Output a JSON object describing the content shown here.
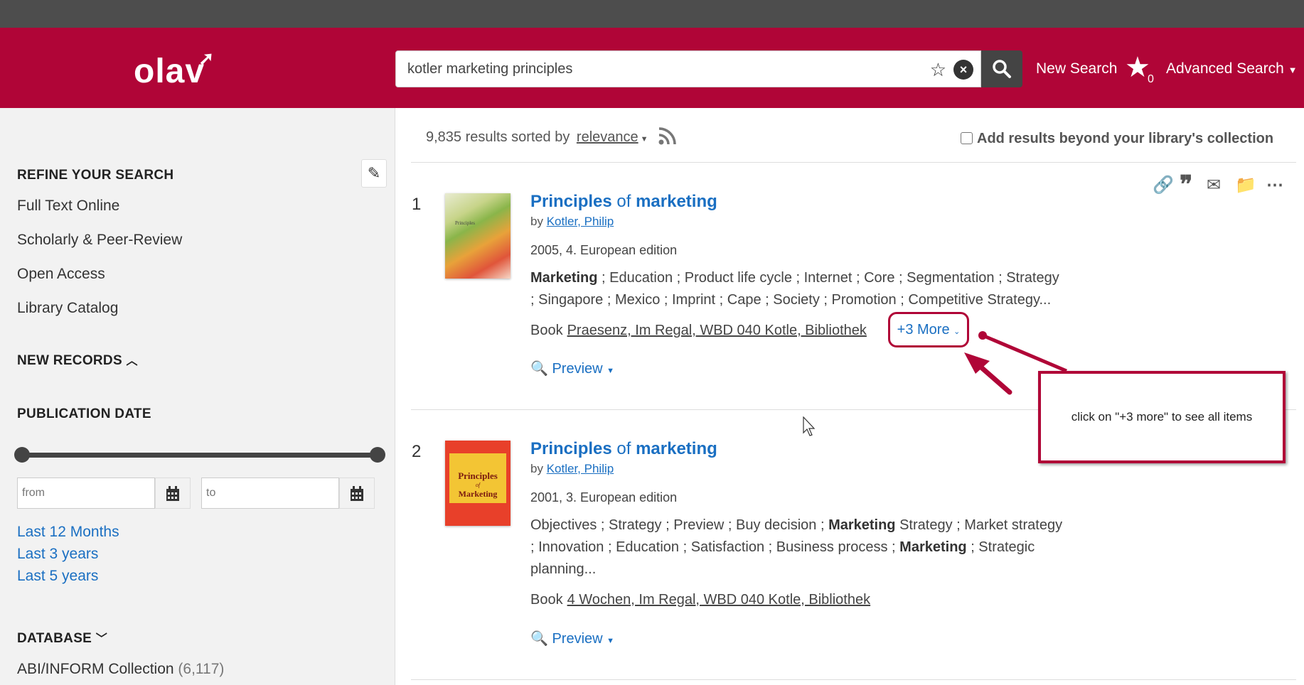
{
  "header": {
    "logo": "olav",
    "search_value": "kotler marketing principles",
    "new_search": "New Search",
    "fav_count": "0",
    "advanced_search": "Advanced Search"
  },
  "sidebar": {
    "refine_heading": "REFINE YOUR SEARCH",
    "refine_items": [
      "Full Text Online",
      "Scholarly & Peer-Review",
      "Open Access",
      "Library Catalog"
    ],
    "new_records": "NEW RECORDS",
    "pub_date": "PUBLICATION DATE",
    "from_placeholder": "from",
    "to_placeholder": "to",
    "date_links": [
      "Last 12 Months",
      "Last 3 years",
      "Last 5 years"
    ],
    "database_heading": "DATABASE",
    "db_first": "ABI/INFORM Collection",
    "db_first_count": "(6,117)"
  },
  "results": {
    "count_text": "9,835 results sorted by",
    "sort": "relevance",
    "beyond": "Add results beyond your library's collection",
    "records": [
      {
        "num": "1",
        "title_a": "Principles",
        "title_b": " of ",
        "title_c": "marketing",
        "by": "by",
        "author": "Kotler, Philip",
        "edition": "2005, 4. European edition",
        "subjects_line1_bold": "Marketing",
        "subjects_line1": " ; Education ; Product life cycle ; Internet ; Core ; Segmentation ; Strategy",
        "subjects_line2": "; Singapore ; Mexico ; Imprint ; Cape ; Society ; Promotion ; Competitive Strategy...",
        "format": "Book",
        "location": "Praesenz, Im Regal, WBD 040 Kotle, Bibliothek",
        "more": "+3 More",
        "preview": "Preview"
      },
      {
        "num": "2",
        "title_a": "Principles",
        "title_b": " of ",
        "title_c": "marketing",
        "by": "by",
        "author": "Kotler, Philip",
        "edition": "2001, 3. European edition",
        "subjects_line1_pre": "Objectives ; Strategy ; Preview ; Buy decision ; ",
        "subjects_line1_bold": "Marketing",
        "subjects_line1_post": " Strategy ; Market strategy",
        "subjects_line2_pre": "; Innovation ; Education ; Satisfaction ; Business process ; ",
        "subjects_line2_bold": "Marketing",
        "subjects_line2_post": " ; Strategic",
        "subjects_line3": "planning...",
        "format": "Book",
        "location": "4 Wochen, Im Regal, WBD 040 Kotle, Bibliothek",
        "preview": "Preview",
        "cover_title": "Principles",
        "cover_of": "of",
        "cover_marketing": "Marketing"
      }
    ]
  },
  "annotation": {
    "text": "click on \"+3 more\" to see all items",
    "color": "#b00537"
  },
  "colors": {
    "brand": "#b00537",
    "link": "#1a6fc2",
    "topbar": "#4d4d4d"
  }
}
